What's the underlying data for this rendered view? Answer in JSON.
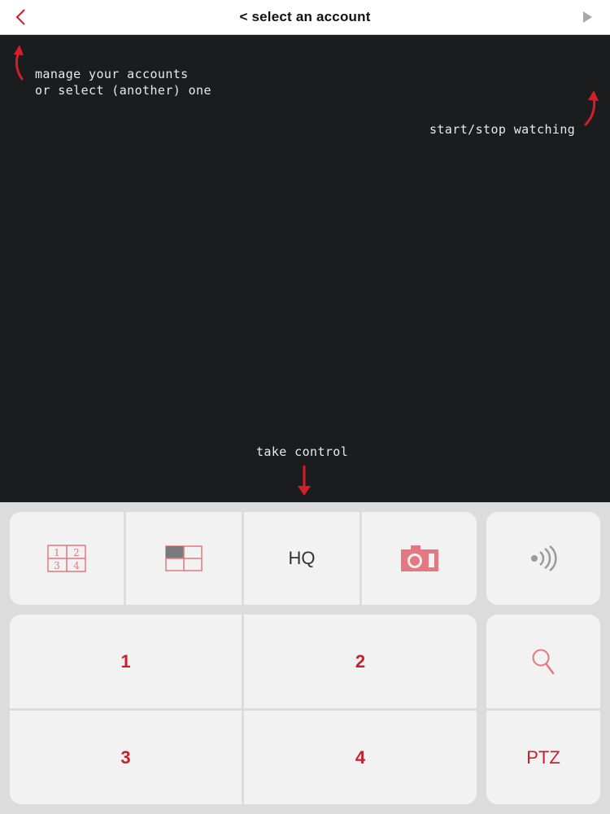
{
  "header": {
    "title": "< select an account",
    "back_icon": "chevron-left-icon",
    "play_icon": "play-icon"
  },
  "annotations": {
    "accounts": "manage your accounts\nor select (another) one",
    "watching": "start/stop watching",
    "control": "take control"
  },
  "toolbar": {
    "grid4_icon": "grid-1-2-3-4-icon",
    "layout_icon": "layout-single-icon",
    "hq_label": "HQ",
    "snapshot_icon": "camera-icon",
    "audio_icon": "speaker-waves-icon"
  },
  "channels": [
    "1",
    "2",
    "3",
    "4"
  ],
  "side": {
    "zoom_icon": "magnifier-icon",
    "ptz_label": "PTZ"
  },
  "colors": {
    "accent": "#c8202c",
    "video_bg": "#1b1c1e",
    "panel_bg": "#f2f2f2",
    "controls_bg": "#dcdcdc",
    "icon_pink": "#e57780"
  }
}
